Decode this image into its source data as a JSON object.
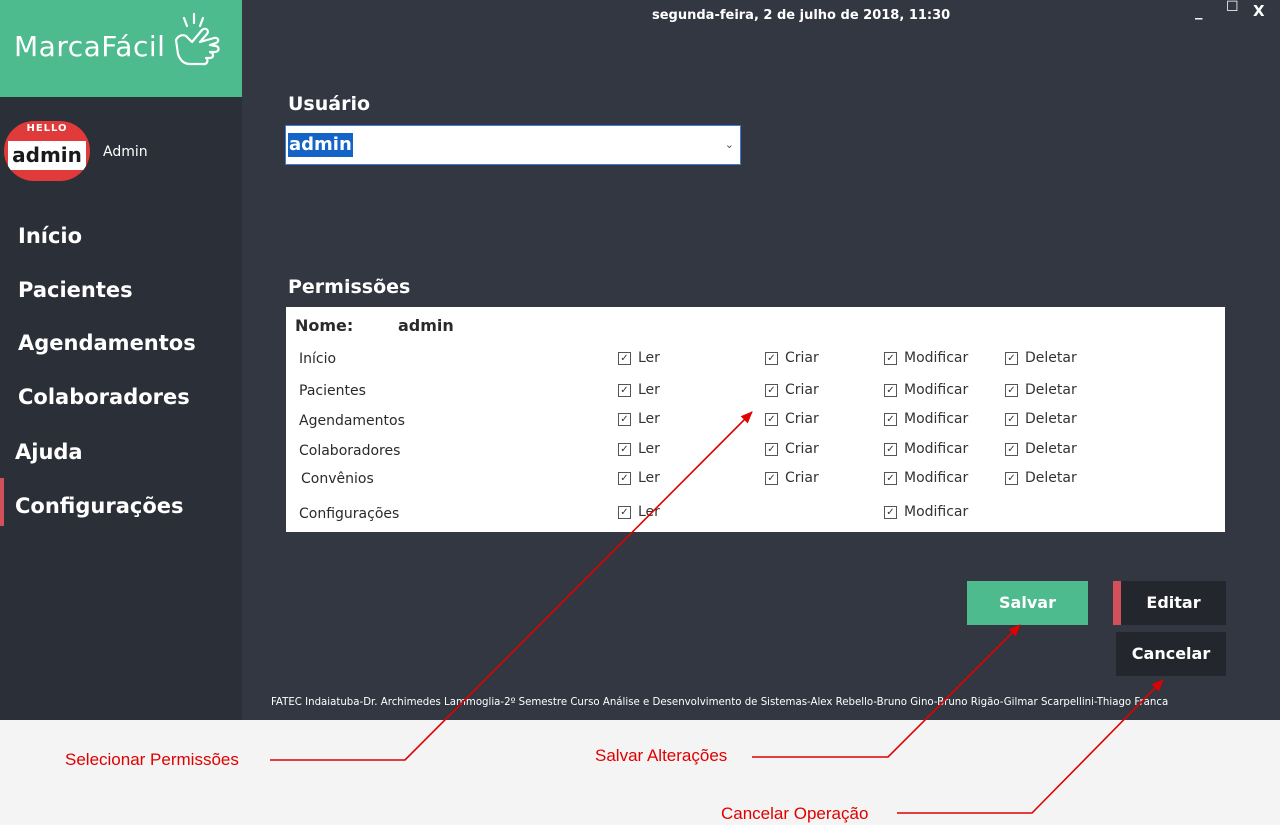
{
  "app": {
    "name": "MarcaFácil",
    "datetime": "segunda-feira, 2 de julho de 2018, 11:30",
    "window_controls": {
      "minimize": "_",
      "maximize": "☐",
      "close": "X"
    }
  },
  "user": {
    "avatar_hello": "HELLO",
    "avatar_name": "admin",
    "name": "Admin"
  },
  "nav": {
    "items": [
      {
        "label": "Início"
      },
      {
        "label": "Pacientes"
      },
      {
        "label": "Agendamentos"
      },
      {
        "label": "Colaboradores"
      },
      {
        "label": "Ajuda"
      },
      {
        "label": "Configurações",
        "active": true
      }
    ]
  },
  "main": {
    "usuario_label": "Usuário",
    "usuario_selected": "admin",
    "permissoes_label": "Permissões",
    "nome_label": "Nome:",
    "nome_value": "admin",
    "permission_rows": [
      {
        "module": "Início",
        "ler": "Ler",
        "criar": "Criar",
        "modificar": "Modificar",
        "deletar": "Deletar"
      },
      {
        "module": "Pacientes",
        "ler": "Ler",
        "criar": "Criar",
        "modificar": "Modificar",
        "deletar": "Deletar"
      },
      {
        "module": "Agendamentos",
        "ler": "Ler",
        "criar": "Criar",
        "modificar": "Modificar",
        "deletar": "Deletar"
      },
      {
        "module": "Colaboradores",
        "ler": "Ler",
        "criar": "Criar",
        "modificar": "Modificar",
        "deletar": "Deletar"
      },
      {
        "module": "Convênios",
        "ler": "Ler",
        "criar": "Criar",
        "modificar": "Modificar",
        "deletar": "Deletar"
      },
      {
        "module": "Configurações",
        "ler": "Ler",
        "modificar": "Modificar"
      }
    ],
    "checkbox_checked": true
  },
  "buttons": {
    "salvar": "Salvar",
    "editar": "Editar",
    "cancelar": "Cancelar"
  },
  "footer": "FATEC Indaiatuba-Dr. Archimedes Lammoglia-2º Semestre Curso Análise e Desenvolvimento de Sistemas-Alex Rebello-Bruno Gino-Bruno Rigão-Gilmar Scarpellini-Thiago Franca",
  "annotations": {
    "selecionar": "Selecionar Permissões",
    "salvar": "Salvar Alterações",
    "cancelar": "Cancelar Operação"
  },
  "colors": {
    "brand_green": "#4dbb8e",
    "sidebar": "#2b2f37",
    "main_bg": "#323741",
    "accent_red": "#d1505c",
    "annotation_red": "#e00000"
  }
}
